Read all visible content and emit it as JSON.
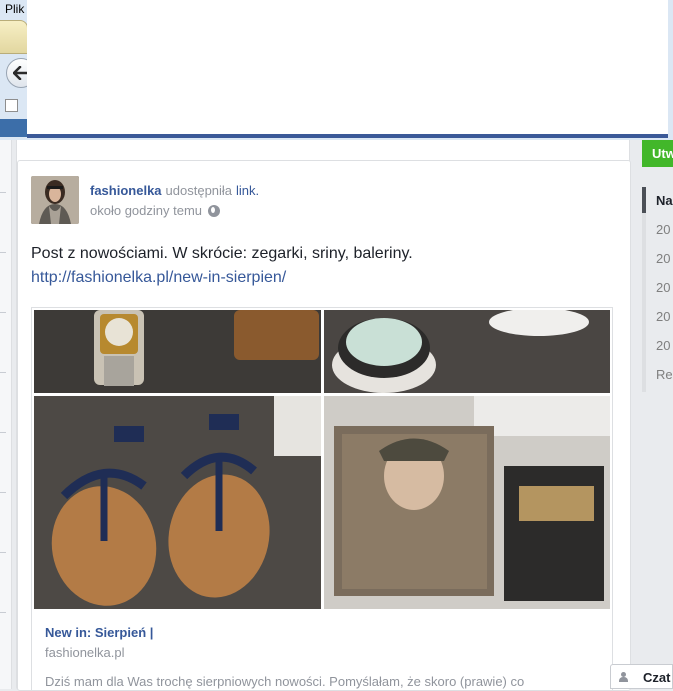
{
  "browser": {
    "menu_file": "Plik"
  },
  "post": {
    "author": "fashionelka",
    "shared_verb": "udostępniła",
    "shared_object": "link.",
    "timestamp": "około godziny temu",
    "text": "Post z nowościami. W skrócie: zegarki, sriny, baleriny.",
    "url": "http://fashionelka.pl/new-in-sierpien/",
    "preview": {
      "title": "New in: Sierpień |",
      "domain": "fashionelka.pl",
      "description": "Dziś mam dla Was trochę sierpniowych nowości. Pomyślałam, że skoro (prawie) co"
    }
  },
  "right_column": {
    "save_button": "Utw",
    "nav_items": [
      "Na",
      "20",
      "20",
      "20",
      "20",
      "20",
      "Re"
    ]
  },
  "chat": {
    "label": "Czat"
  },
  "colors": {
    "facebook_blue": "#3b5998",
    "link_blue": "#365899",
    "save_green": "#42b72a"
  }
}
